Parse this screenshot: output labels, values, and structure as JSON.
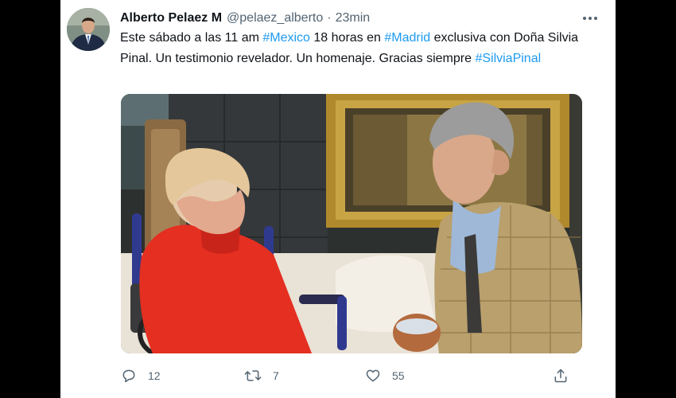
{
  "tweet": {
    "author": {
      "name": "Alberto Pelaez M",
      "handle": "@pelaez_alberto"
    },
    "separator": "·",
    "timestamp": "23min",
    "text": {
      "part1": "Este sábado a las 11 am ",
      "hashtag1": "#Mexico",
      "part2": " 18 horas en ",
      "hashtag2": "#Madrid",
      "part3": " exclusiva con Doña Silvia Pinal. Un testimonio revelador. Un homenaje. Gracias siempre ",
      "hashtag3": "#SilviaPinal"
    },
    "actions": {
      "reply_count": "12",
      "retweet_count": "7",
      "like_count": "55"
    }
  },
  "icons": {
    "more": "more-dots-icon",
    "reply": "reply-bubble-icon",
    "retweet": "retweet-icon",
    "like": "heart-icon",
    "share": "share-upload-icon"
  },
  "colors": {
    "link": "#1d9bf0",
    "secondary_text": "#536471",
    "primary_text": "#0f1419",
    "background": "#ffffff",
    "outer_background": "#000000"
  }
}
